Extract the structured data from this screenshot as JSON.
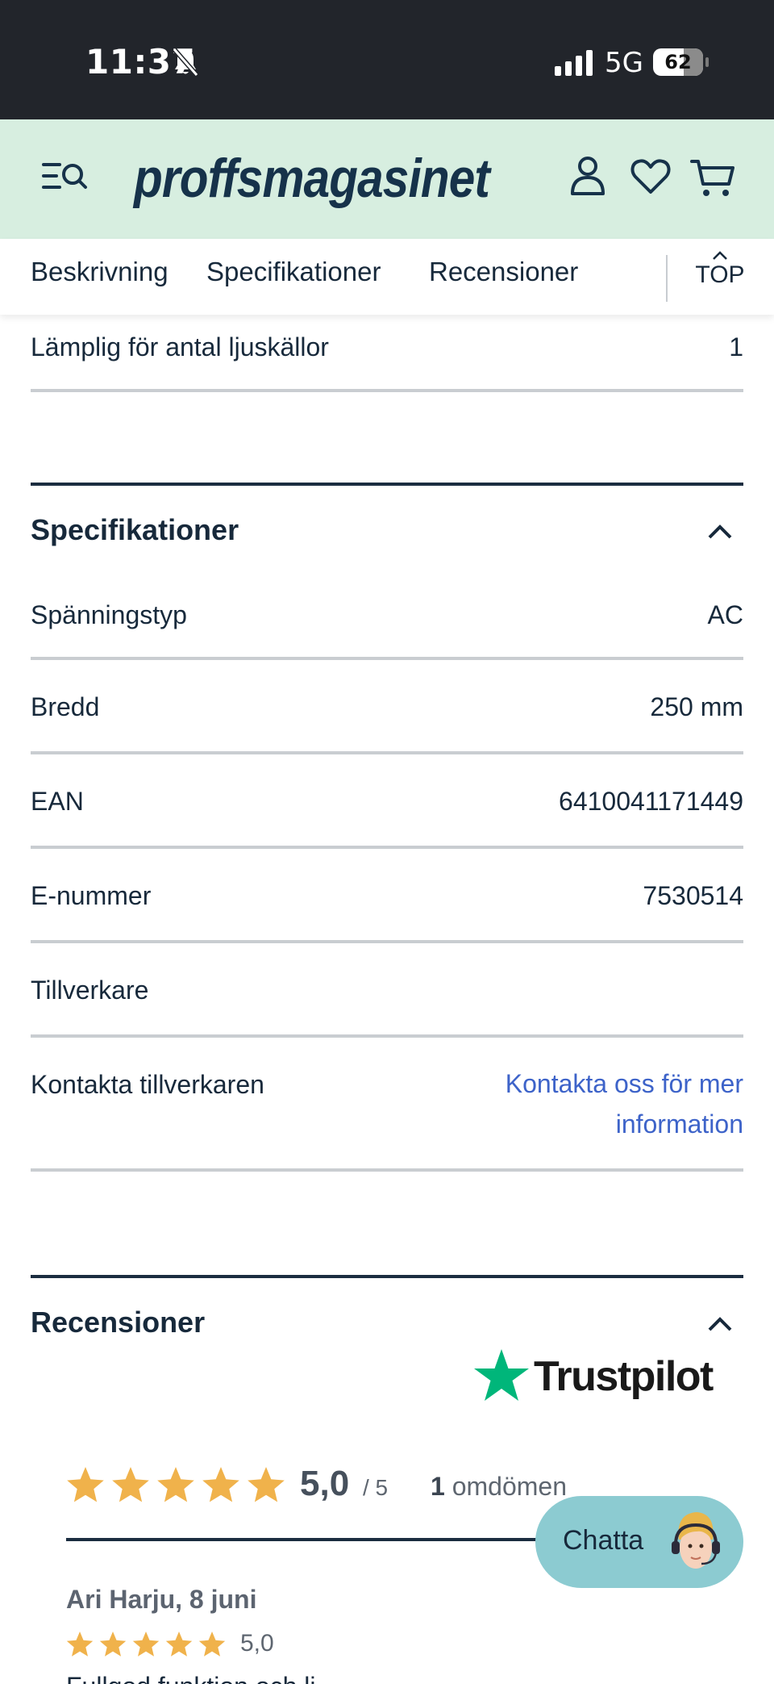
{
  "status_bar": {
    "time": "11:37",
    "network": "5G",
    "battery": "62",
    "battery_level": 0.62
  },
  "header": {
    "logo": "proffsmagasinet"
  },
  "tabs": [
    {
      "label": "Beskrivning"
    },
    {
      "label": "Specifikationer"
    },
    {
      "label": "Recensioner"
    }
  ],
  "top_button": {
    "label": "TOP"
  },
  "description_tail": {
    "label": "Lämplig för antal ljuskällor",
    "value": "1"
  },
  "specifications": {
    "title": "Specifikationer",
    "rows": [
      {
        "label": "Spänningstyp",
        "value": "AC"
      },
      {
        "label": "Bredd",
        "value": "250 mm"
      },
      {
        "label": "EAN",
        "value": "6410041171449"
      },
      {
        "label": "E-nummer",
        "value": "7530514"
      },
      {
        "label": "Tillverkare",
        "value": ""
      }
    ],
    "contact": {
      "label": "Kontakta tillverkaren",
      "link_line1": "Kontakta oss för mer",
      "link_line2": "information"
    }
  },
  "reviews": {
    "title": "Recensioner",
    "provider": "Trustpilot",
    "score": "5,0",
    "max": "/ 5",
    "count": "1",
    "count_label": "omdömen",
    "star_rating": 5,
    "star_color": "#f0b24b",
    "items": [
      {
        "author": "Ari Harju, 8 juni",
        "score": "5,0",
        "text": "Fullgod funktion och lj..."
      }
    ]
  },
  "chat": {
    "label": "Chatta"
  },
  "colors": {
    "header_bg": "#d7eee0",
    "link": "#3d63c9",
    "trustpilot_green": "#00b67a",
    "chat_bg": "#8ccbd1"
  }
}
